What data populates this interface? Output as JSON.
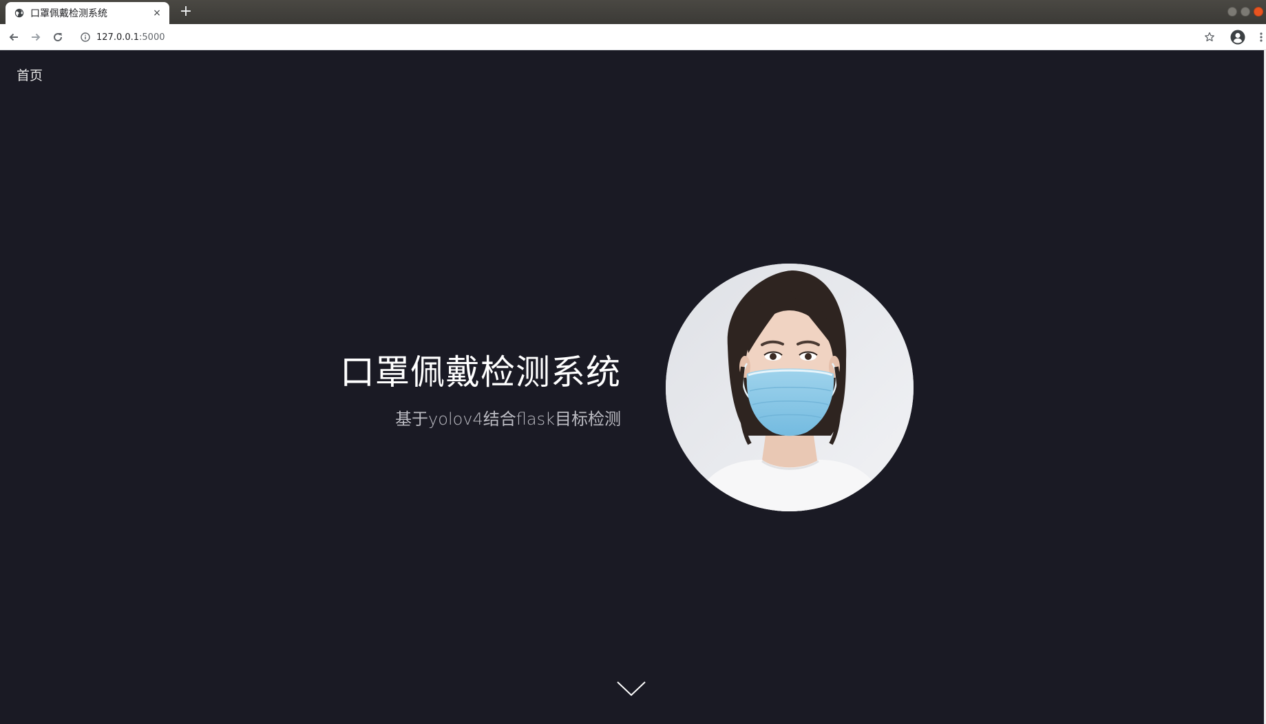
{
  "browser": {
    "tab": {
      "title": "口罩佩戴检测系统",
      "close_icon": "×"
    },
    "new_tab_icon": "+",
    "address": {
      "host": "127.0.0.1",
      "port": ":5000"
    }
  },
  "nav": {
    "home_label": "首页"
  },
  "hero": {
    "title": "口罩佩戴检测系统",
    "subtitle": "基于yolov4结合flask目标检测",
    "image_icon": "masked-woman-portrait"
  },
  "scroll_icon": "chevron-down-icon",
  "colors": {
    "page_background": "#1a1a24",
    "title_text": "#ffffff",
    "subtitle_text": "#bdbdc4",
    "mask_blue": "#8ccbe8"
  }
}
